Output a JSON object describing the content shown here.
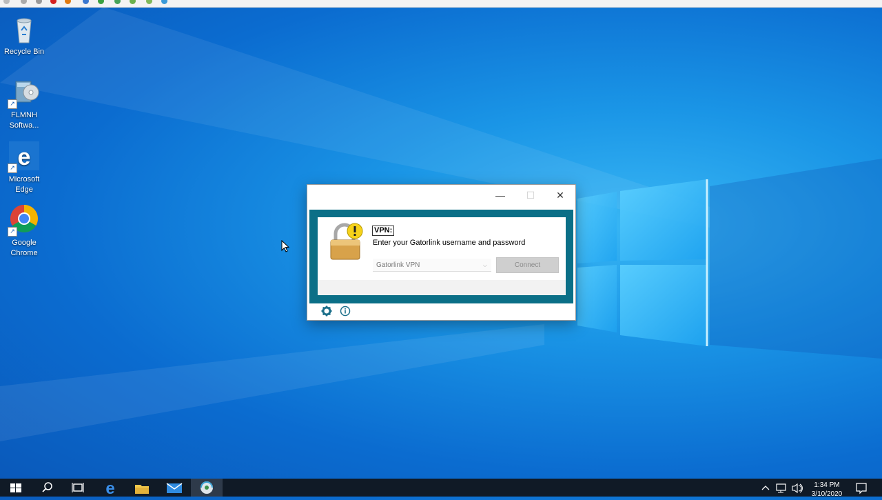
{
  "desktop": {
    "icons": [
      {
        "label": "Recycle Bin",
        "icon": "recycle-bin-icon"
      },
      {
        "label": "FLMNH Softwa...",
        "icon": "installer-icon"
      },
      {
        "label": "Microsoft Edge",
        "icon": "edge-icon"
      },
      {
        "label": "Google Chrome",
        "icon": "chrome-icon"
      }
    ]
  },
  "dialog": {
    "minimize": "—",
    "maximize": "☐",
    "close": "✕",
    "vpn_label": "VPN:",
    "prompt": "Enter your Gatorlink username and password",
    "connection_value": "Gatorlink VPN",
    "dropdown_arrow": "⌵",
    "connect_label": "Connect"
  },
  "taskbar": {
    "items": [
      "start-icon",
      "search-icon",
      "task-view-icon",
      "edge-icon",
      "file-explorer-icon",
      "mail-icon",
      "vpn-client-icon"
    ],
    "clock_time": "1:34 PM",
    "clock_date": "3/10/2020"
  },
  "colors": {
    "desktop_blue": "#0b6cd0",
    "dialog_teal": "#0b6f87",
    "taskbar": "#101a26"
  }
}
